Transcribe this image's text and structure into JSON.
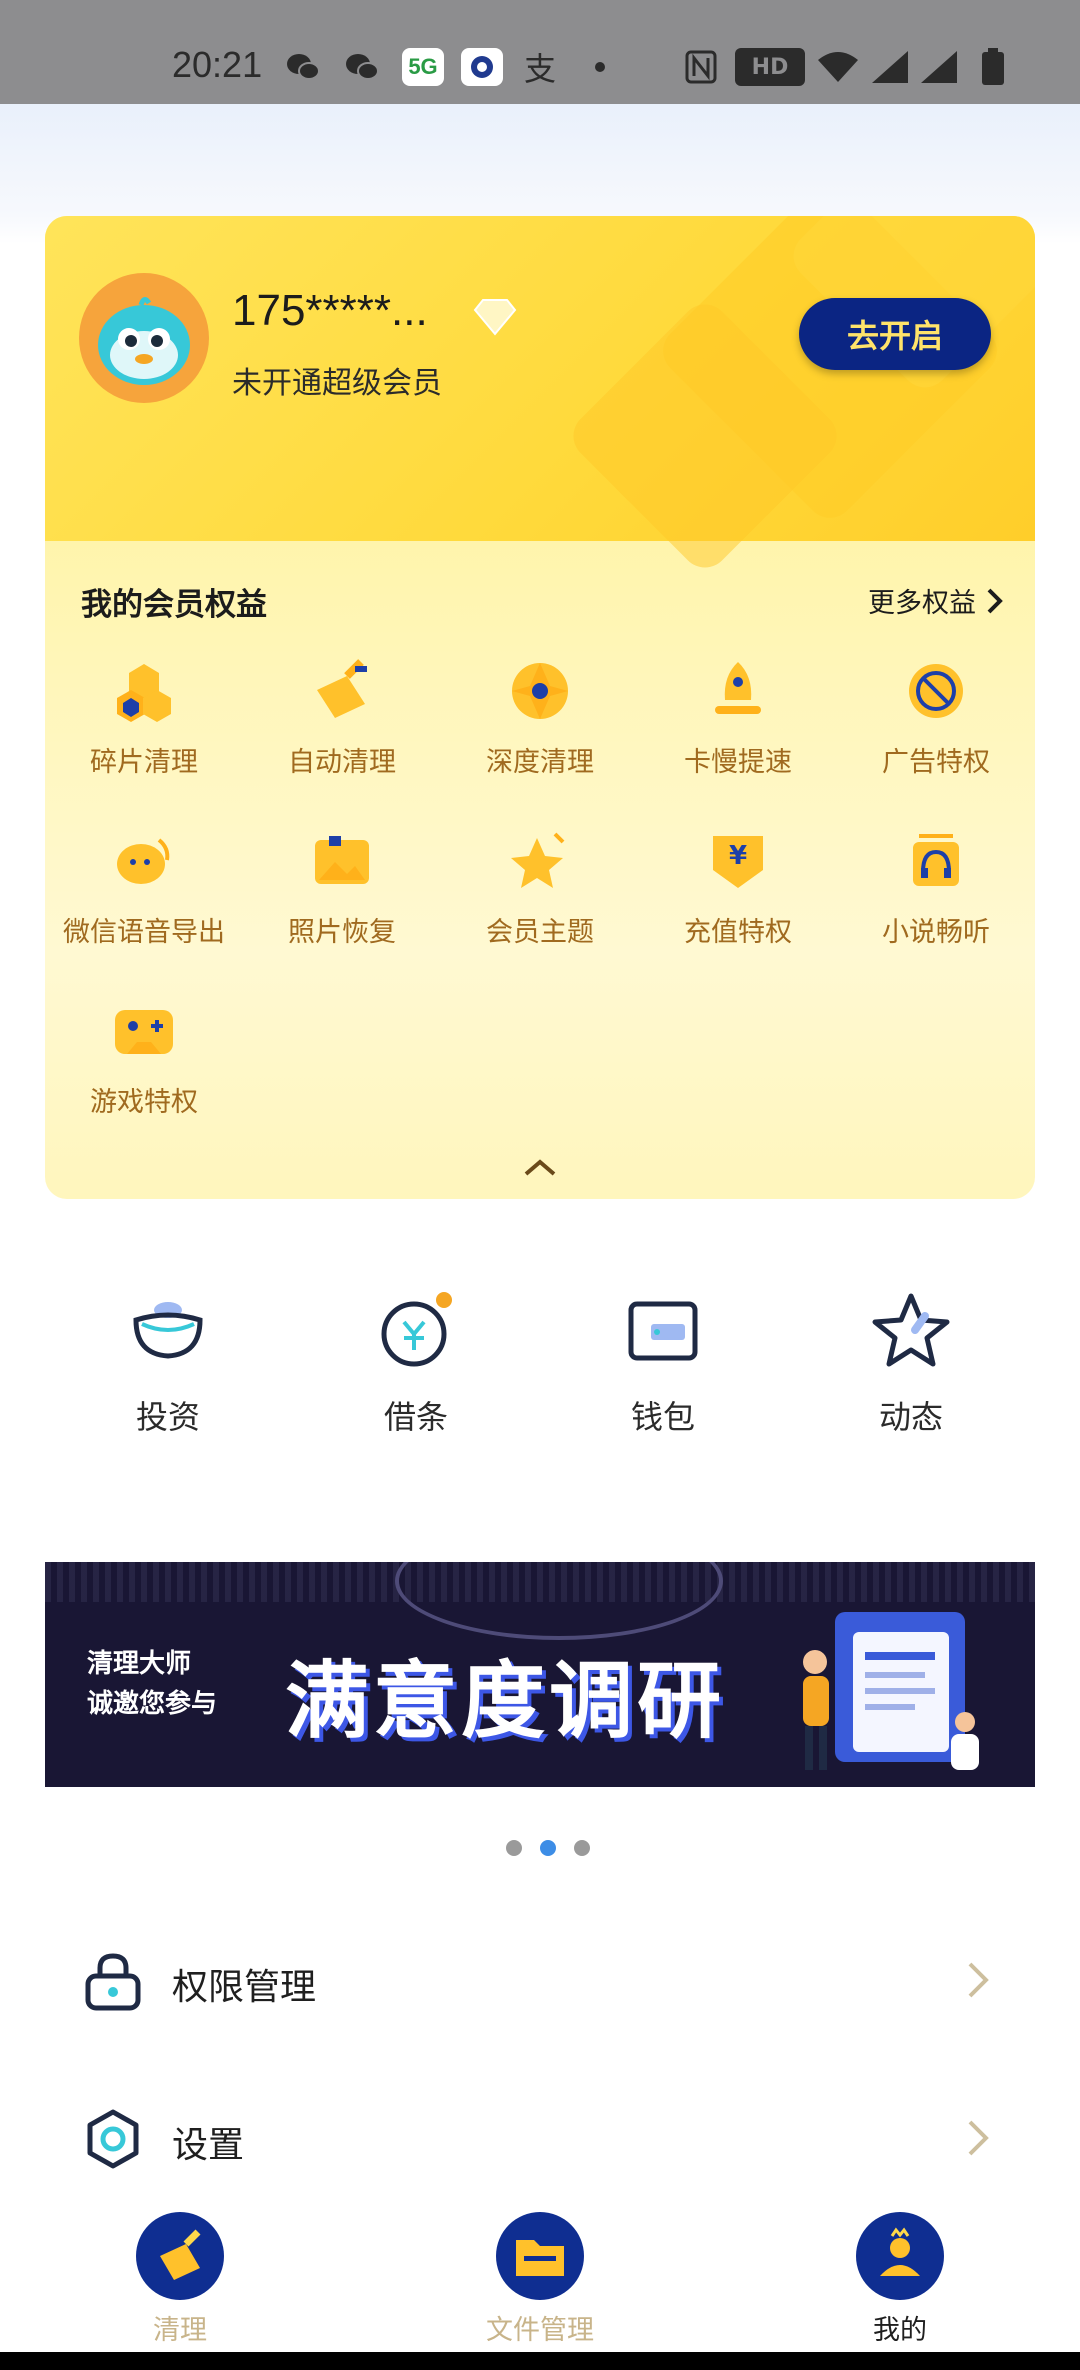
{
  "status_bar": {
    "time": "20:21",
    "network": "5G"
  },
  "member_card": {
    "phone": "175*****...",
    "subtitle": "未开通超级会员",
    "open_button": "去开启",
    "rights_title": "我的会员权益",
    "more_rights": "更多权益",
    "rights": [
      {
        "label": "碎片清理",
        "icon": "fragment-clean-icon"
      },
      {
        "label": "自动清理",
        "icon": "auto-clean-icon"
      },
      {
        "label": "深度清理",
        "icon": "deep-clean-icon"
      },
      {
        "label": "卡慢提速",
        "icon": "speedup-icon"
      },
      {
        "label": "广告特权",
        "icon": "ad-privilege-icon"
      },
      {
        "label": "微信语音导出",
        "icon": "wechat-voice-icon"
      },
      {
        "label": "照片恢复",
        "icon": "photo-recovery-icon"
      },
      {
        "label": "会员主题",
        "icon": "member-theme-icon"
      },
      {
        "label": "充值特权",
        "icon": "recharge-icon"
      },
      {
        "label": "小说畅听",
        "icon": "novel-listen-icon"
      },
      {
        "label": "游戏特权",
        "icon": "game-icon"
      }
    ]
  },
  "quick_actions": [
    {
      "label": "投资",
      "icon": "invest-icon"
    },
    {
      "label": "借条",
      "icon": "loan-icon"
    },
    {
      "label": "钱包",
      "icon": "wallet-icon"
    },
    {
      "label": "动态",
      "icon": "star-icon"
    }
  ],
  "banner": {
    "line1": "清理大师",
    "line2": "诚邀您参与",
    "headline": "满意度调研",
    "active_dot": 1,
    "dot_count": 3
  },
  "menu": [
    {
      "label": "权限管理",
      "icon": "lock-icon"
    },
    {
      "label": "设置",
      "icon": "gear-icon"
    }
  ],
  "bottom_nav": [
    {
      "label": "清理",
      "icon": "broom-icon"
    },
    {
      "label": "文件管理",
      "icon": "folder-icon"
    },
    {
      "label": "我的",
      "icon": "profile-icon",
      "active": true
    }
  ],
  "colors": {
    "accent_navy": "#0b2583",
    "gold_text": "#a06a1f",
    "card_yellow": "#ffe45a",
    "nav_inactive": "#c8b48a",
    "nav_active": "#1f1f1f"
  }
}
